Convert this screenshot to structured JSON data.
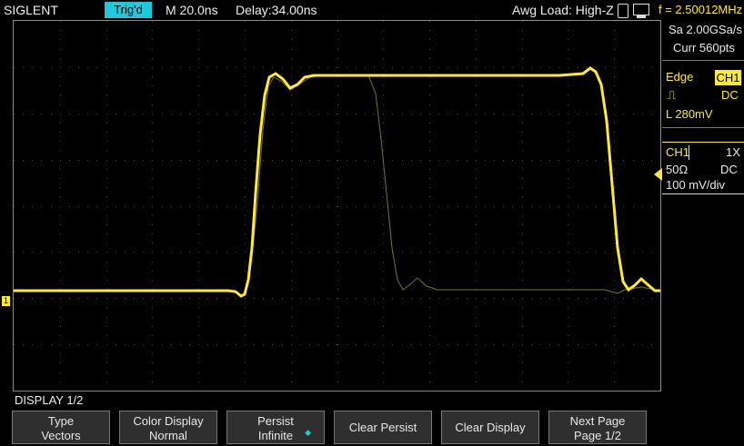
{
  "topbar": {
    "brand": "SIGLENT",
    "trigger_status": "Trig'd",
    "timebase": "M 20.0ns",
    "delay": "Delay:34.00ns",
    "awg_load": "Awg Load: High-Z",
    "frequency": "f = 2.50012MHz"
  },
  "acquisition": {
    "sample_rate": "Sa 2.00GSa/s",
    "current_points": "Curr 560pts"
  },
  "trigger": {
    "type": "Edge",
    "source": "CH1",
    "coupling": "DC",
    "level": "L  280mV"
  },
  "channel": {
    "name": "CH1",
    "probe": "1X",
    "impedance": "50Ω",
    "coupling": "DC",
    "scale": "100 mV/div",
    "marker": "1"
  },
  "menu": {
    "title": "DISPLAY 1/2",
    "softkeys": [
      {
        "line1": "Type",
        "line2": "Vectors"
      },
      {
        "line1": "Color Display",
        "line2": "Normal"
      },
      {
        "line1": "Persist",
        "line2": "Infinite"
      },
      {
        "line1": "Clear Persist",
        "line2": ""
      },
      {
        "line1": "Clear Display",
        "line2": ""
      },
      {
        "line1": "Next Page",
        "line2": "Page 1/2"
      }
    ]
  },
  "colors": {
    "trace": "#ffe838",
    "accent": "#20c8d8",
    "persist_trace": "#8c8a2a"
  }
}
